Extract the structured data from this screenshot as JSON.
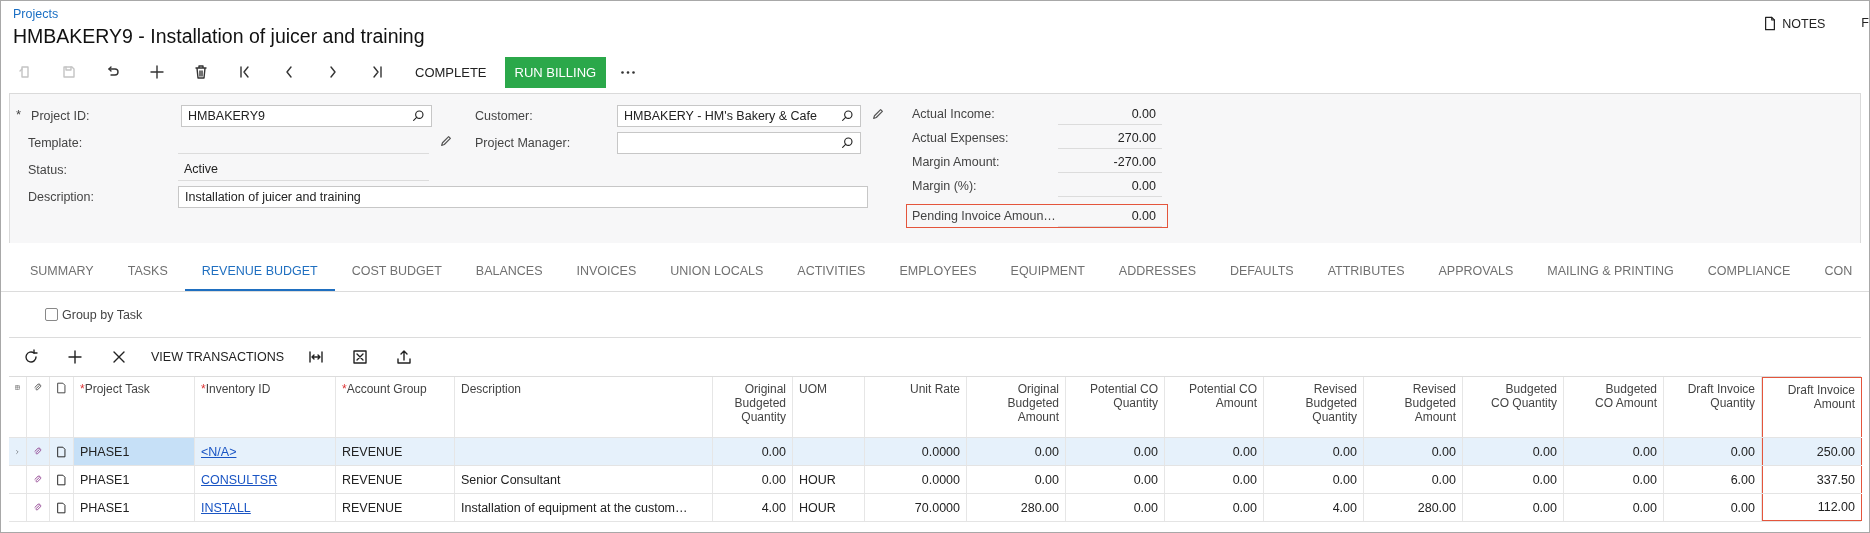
{
  "breadcrumb": "Projects",
  "title": "HMBAKERY9 - Installation of juicer and training",
  "top_actions": [
    {
      "label": "NOTES",
      "kind": "notes"
    },
    {
      "label": "F",
      "kind": "plain"
    }
  ],
  "toolbar": {
    "icon_buttons": [
      {
        "disabled": true
      },
      {
        "disabled": true
      },
      {
        "disabled": false
      },
      {
        "disabled": false
      },
      {
        "disabled": false
      },
      {
        "disabled": false
      },
      {
        "disabled": false
      },
      {
        "disabled": false
      },
      {
        "disabled": false
      }
    ],
    "actions": [
      {
        "label": "COMPLETE",
        "kind": "plain"
      },
      {
        "label": "RUN BILLING",
        "kind": "primary"
      }
    ]
  },
  "form": {
    "left": [
      {
        "label": "Project ID:",
        "value": "HMBAKERY9",
        "kind": "lookup",
        "required_mark": "*"
      },
      {
        "label": "Template:",
        "kind": "edit_line"
      },
      {
        "label": "Status:",
        "value": "Active",
        "kind": "readonly"
      },
      {
        "label": "Description:",
        "value": "Installation of juicer and training",
        "kind": "input"
      }
    ],
    "middle": [
      {
        "label": "Customer:",
        "value": "HMBAKERY - HM's Bakery & Cafe",
        "kind": "lookup",
        "pencil": true
      },
      {
        "label": "Project Manager:",
        "kind": "lookup",
        "pencil": false
      }
    ],
    "summary": [
      {
        "label": "Actual Income:",
        "value": "0.00",
        "highlighted": false
      },
      {
        "label": "Actual Expenses:",
        "value": "270.00",
        "highlighted": false
      },
      {
        "label": "Margin Amount:",
        "value": "-270.00",
        "highlighted": false
      },
      {
        "label": "Margin (%):",
        "value": "0.00",
        "highlighted": false
      },
      {
        "label": "Pending Invoice Amoun…",
        "value": "0.00",
        "highlighted": true
      }
    ]
  },
  "tabs": [
    {
      "label": "SUMMARY",
      "selected": false
    },
    {
      "label": "TASKS",
      "selected": false
    },
    {
      "label": "REVENUE BUDGET",
      "selected": true
    },
    {
      "label": "COST BUDGET",
      "selected": false
    },
    {
      "label": "BALANCES",
      "selected": false
    },
    {
      "label": "INVOICES",
      "selected": false
    },
    {
      "label": "UNION LOCALS",
      "selected": false
    },
    {
      "label": "ACTIVITIES",
      "selected": false
    },
    {
      "label": "EMPLOYEES",
      "selected": false
    },
    {
      "label": "EQUIPMENT",
      "selected": false
    },
    {
      "label": "ADDRESSES",
      "selected": false
    },
    {
      "label": "DEFAULTS",
      "selected": false
    },
    {
      "label": "ATTRIBUTES",
      "selected": false
    },
    {
      "label": "APPROVALS",
      "selected": false
    },
    {
      "label": "MAILING & PRINTING",
      "selected": false
    },
    {
      "label": "COMPLIANCE",
      "selected": false
    },
    {
      "label": "CON",
      "selected": false
    }
  ],
  "group_by_task": {
    "label": "Group by Task",
    "checked": false
  },
  "grid_toolbar": {
    "action": "VIEW TRANSACTIONS"
  },
  "table": {
    "columns": [
      {
        "label": "Project Task",
        "required_mark": "*",
        "kind": "text",
        "highlighted": false
      },
      {
        "label": "Inventory ID",
        "required_mark": "*",
        "kind": "link",
        "highlighted": false
      },
      {
        "label": "Account Group",
        "required_mark": "*",
        "kind": "text",
        "highlighted": false
      },
      {
        "label": "Description",
        "kind": "text",
        "highlighted": false
      },
      {
        "label": "Original\nBudgeted\nQuantity",
        "kind": "number",
        "highlighted": false
      },
      {
        "label": "UOM",
        "kind": "text",
        "highlighted": false
      },
      {
        "label": "Unit Rate",
        "kind": "number",
        "highlighted": false
      },
      {
        "label": "Original\nBudgeted\nAmount",
        "kind": "number",
        "highlighted": false
      },
      {
        "label": "Potential CO\nQuantity",
        "kind": "number",
        "highlighted": false
      },
      {
        "label": "Potential CO\nAmount",
        "kind": "number",
        "highlighted": false
      },
      {
        "label": "Revised\nBudgeted\nQuantity",
        "kind": "number",
        "highlighted": false
      },
      {
        "label": "Revised\nBudgeted\nAmount",
        "kind": "number",
        "highlighted": false
      },
      {
        "label": "Budgeted\nCO Quantity",
        "kind": "number",
        "highlighted": false
      },
      {
        "label": "Budgeted\nCO Amount",
        "kind": "number",
        "highlighted": false
      },
      {
        "label": "Draft Invoice\nQuantity",
        "kind": "number",
        "highlighted": false
      },
      {
        "label": "Draft Invoice\nAmount",
        "kind": "number",
        "highlighted": true
      }
    ],
    "rows": [
      {
        "selected": true,
        "cells": [
          "PHASE1",
          "<N/A>",
          "REVENUE",
          null,
          "0.00",
          null,
          "0.0000",
          "0.00",
          "0.00",
          "0.00",
          "0.00",
          "0.00",
          "0.00",
          "0.00",
          "0.00",
          "250.00"
        ]
      },
      {
        "selected": false,
        "cells": [
          "PHASE1",
          "CONSULTSR",
          "REVENUE",
          "Senior Consultant",
          "0.00",
          "HOUR",
          "0.0000",
          "0.00",
          "0.00",
          "0.00",
          "0.00",
          "0.00",
          "0.00",
          "0.00",
          "6.00",
          "337.50"
        ]
      },
      {
        "selected": false,
        "cells": [
          "PHASE1",
          "INSTALL",
          "REVENUE",
          "Installation of equipment at the custom…",
          "4.00",
          "HOUR",
          "70.0000",
          "280.00",
          "0.00",
          "0.00",
          "4.00",
          "280.00",
          "0.00",
          "0.00",
          "0.00",
          "112.00"
        ]
      }
    ]
  }
}
